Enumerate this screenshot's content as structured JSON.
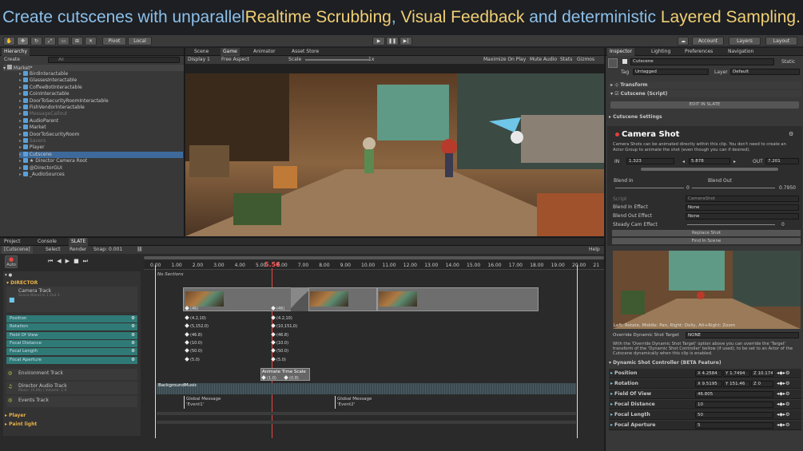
{
  "banner": {
    "p1": "Create cutscenes with unparallel ",
    "p2": "Realtime Scrubbing",
    "p3": ", ",
    "p4": "Visual Feedback",
    "p5": " and deterministic ",
    "p6": "Layered Sampling",
    "p7": "."
  },
  "toolbar": {
    "pivot": "Pivot",
    "local": "Local",
    "account": "Account",
    "layers": "Layers",
    "layout": "Layout"
  },
  "hierarchy": {
    "tab": "Hierarchy",
    "create": "Create",
    "search": "All",
    "scene": "Market*",
    "items": [
      {
        "label": "BirdInteractable",
        "dim": false
      },
      {
        "label": "GlassesInteractable",
        "dim": false
      },
      {
        "label": "CoffeeBotInteractable",
        "dim": false
      },
      {
        "label": "CoinInteractable",
        "dim": false
      },
      {
        "label": "DoorToSecurityRoomInteractable",
        "dim": false
      },
      {
        "label": "FishVendorInteractable",
        "dim": false
      },
      {
        "label": "MessageCallout",
        "dim": true
      },
      {
        "label": "AudioParent",
        "dim": false
      },
      {
        "label": "Market",
        "dim": false
      },
      {
        "label": "DoorToSecurityRoom",
        "dim": false
      },
      {
        "label": "Savers",
        "dim": true
      },
      {
        "label": "Player",
        "dim": false
      },
      {
        "label": "Cutscene",
        "dim": false
      },
      {
        "label": "★ Director Camera Root",
        "dim": false
      },
      {
        "label": "@DirectorGUI",
        "dim": false
      },
      {
        "label": "_AudioSources",
        "dim": false
      }
    ]
  },
  "sceneTabs": [
    "Scene",
    "Game",
    "Animator",
    "Asset Store"
  ],
  "gameBar": {
    "display": "Display 1",
    "aspect": "Free Aspect",
    "scale": "Scale",
    "scaleVal": "1x",
    "maximize": "Maximize On Play",
    "mute": "Mute Audio",
    "stats": "Stats",
    "gizmos": "Gizmos"
  },
  "bottomTabs": [
    "Project",
    "Console",
    "SLATE"
  ],
  "slate": {
    "cutscene": "[Cutscene]",
    "select": "Select",
    "render": "Render",
    "snap": "Snap: 0.001",
    "help": "Help",
    "auto": "Auto",
    "ticks": [
      "0.00",
      "1.00",
      "2.00",
      "3.00",
      "4.00",
      "5.00",
      "6.00",
      "7.00",
      "8.00",
      "9.00",
      "10.00",
      "11.00",
      "12.00",
      "13.00",
      "14.00",
      "15.00",
      "16.00",
      "17.00",
      "18.00",
      "19.00",
      "20.00",
      "21"
    ],
    "currentTime": "5.56",
    "noSections": "No Sections",
    "director": "DIRECTOR",
    "cameraTrack": "Camera Track",
    "cameraTrackSub": "Scene Blend In 1 Out 1",
    "params": [
      "Position",
      "Rotation",
      "Field Of View",
      "Focal Distance",
      "Focal Length",
      "Focal Aperture"
    ],
    "kfLeft": [
      "(4.2,10)",
      "(5,152,0)",
      "(46.8)",
      "(10.0)",
      "(50.0)",
      "(5.0)"
    ],
    "kfRight": [
      "(4.2,10)",
      "(10,151,0)",
      "(46.8)",
      "(10.0)",
      "(50.0)",
      "(5.0)"
    ],
    "clipLabel": "(46)",
    "clipLabel2": "(46)",
    "envTrack": "Environment Track",
    "animateTimeScale": "Animate Time Scale",
    "atsVals": [
      "(1.0)",
      "(0.8)"
    ],
    "audioTrack": "Director Audio Track",
    "audioSub": "Music: (0.00) | Volume: 1.0",
    "audioClip": "BackgroundMusic",
    "eventsTrack": "Events Track",
    "msg1": "Global Message",
    "msg1b": "'Event1'",
    "msg2": "Global Message",
    "msg2b": "'Event2'",
    "player": "Player",
    "paintLight": "Paint light"
  },
  "inspector": {
    "tabs": [
      "Inspector",
      "Lighting",
      "Preferences",
      "Navigation"
    ],
    "objName": "Cutscene",
    "static": "Static",
    "tag": "Tag",
    "tagVal": "Untagged",
    "layer": "Layer",
    "layerVal": "Default",
    "transform": "Transform",
    "script": "Cutscene (Script)",
    "editInSlate": "EDIT IN SLATE",
    "cutsceneSettings": "Cutscene Settings",
    "cameraShot": "Camera Shot",
    "desc": "Camera Shots can be animated directly within this clip. You don't need to create an Actor Group to animate the shot (even though you can if desired).",
    "inLbl": "IN",
    "inVal": "1.323",
    "len": "5.878",
    "outLbl": "OUT",
    "outVal": "7.201",
    "blendIn": "Blend In",
    "blendOut": "Blend Out",
    "blendInVal": "0",
    "blendOutVal": "0.7950",
    "scriptLbl": "Script",
    "scriptVal": "CameraShot",
    "blendInEffect": "Blend In Effect",
    "blendInEffectVal": "None",
    "blendOutEffect": "Blend Out Effect",
    "blendOutEffectVal": "None",
    "steadyCam": "Steady Cam Effect",
    "steadyVal": "0",
    "replaceShot": "Replace Shot",
    "findInScene": "Find In Scene",
    "previewHint": "Left: Rotate, Middle: Pan, Right: Dolly, Alt+Right: Zoom",
    "override": "Override Dynamic Shot Target",
    "overrideVal": "NONE",
    "overrideDesc": "With the 'Override Dynamic Shot Target' option above you can override the 'Target' transform of the 'Dynamic Shot Controller' bellow (if used), to be set to an Actor of the Cutscene dynamically when this clip is enabled.",
    "dsc": "Dynamic Shot Controller (BETA Feature)",
    "rows": [
      {
        "label": "Position",
        "x": "4.2584",
        "y": "1.7494",
        "z": "10.174"
      },
      {
        "label": "Rotation",
        "x": "9.5195",
        "y": "151.46",
        "z": "0"
      },
      {
        "label": "Field Of View",
        "v": "46.805"
      },
      {
        "label": "Focal Distance",
        "v": "10"
      },
      {
        "label": "Focal Length",
        "v": "50"
      },
      {
        "label": "Focal Aperture",
        "v": "5"
      }
    ]
  }
}
